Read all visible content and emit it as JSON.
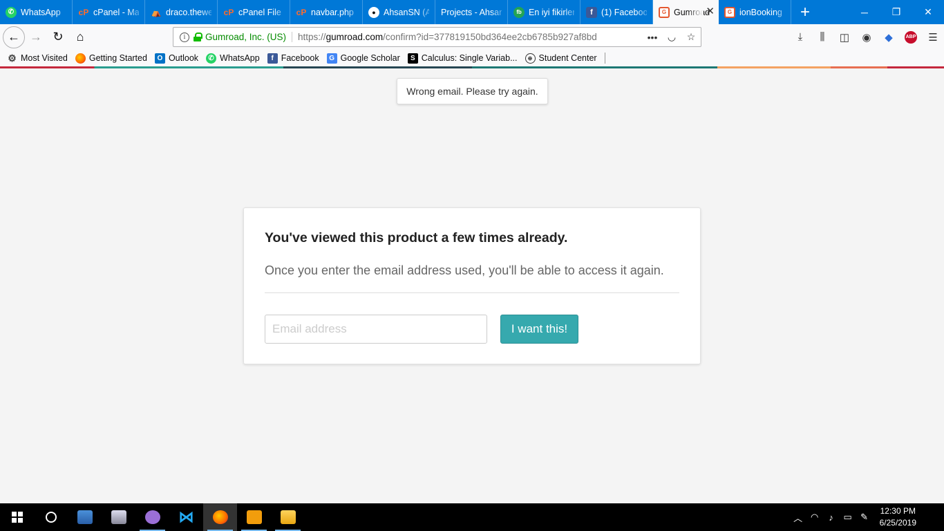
{
  "tabs": [
    {
      "label": "WhatsApp",
      "icon": "whatsapp-icon"
    },
    {
      "label": "cPanel - Ma",
      "icon": "cpanel-icon"
    },
    {
      "label": "draco.thewe",
      "icon": "draco-icon"
    },
    {
      "label": "cPanel File M",
      "icon": "cpanel-icon"
    },
    {
      "label": "navbar.php",
      "icon": "cpanel-icon"
    },
    {
      "label": "AhsanSN (A",
      "icon": "github-icon"
    },
    {
      "label": "Projects - Ahsan",
      "icon": "none"
    },
    {
      "label": "En iyi fikirler",
      "icon": "fb-green-icon"
    },
    {
      "label": "(1) Faceboo",
      "icon": "facebook-icon"
    },
    {
      "label": "Gumroad",
      "icon": "gumroad-icon",
      "active": true
    },
    {
      "label": "ionBooking",
      "icon": "gumroad-icon"
    }
  ],
  "window": {
    "minimize": "─",
    "restore": "❐",
    "close": "✕"
  },
  "urlbar": {
    "site_identity": "Gumroad, Inc. (US)",
    "url_prefix": "https://",
    "url_host": "gumroad.com",
    "url_path": "/confirm?id=377819150bd364ee2cb6785b927af8bd"
  },
  "bookmarks": [
    {
      "label": "Most Visited",
      "icon": "gear-icon"
    },
    {
      "label": "Getting Started",
      "icon": "firefox-icon"
    },
    {
      "label": "Outlook",
      "icon": "outlook-icon"
    },
    {
      "label": "WhatsApp",
      "icon": "whatsapp-icon"
    },
    {
      "label": "Facebook",
      "icon": "facebook-icon"
    },
    {
      "label": "Google Scholar",
      "icon": "google-scholar-icon"
    },
    {
      "label": "Calculus: Single Variab...",
      "icon": "s-icon"
    },
    {
      "label": "Student Center",
      "icon": "globe-icon"
    }
  ],
  "page": {
    "flash_message": "Wrong email. Please try again.",
    "heading": "You've viewed this product a few times already.",
    "subtext": "Once you enter the email address used, you'll be able to access it again.",
    "email_placeholder": "Email address",
    "email_value": "",
    "submit_label": "I want this!"
  },
  "taskbar": {
    "clock_time": "12:30 PM",
    "clock_date": "6/25/2019"
  },
  "colors": {
    "tabbar": "#0078d7",
    "accent_button": "#36a9ae",
    "site_identity_green": "#058b00"
  }
}
